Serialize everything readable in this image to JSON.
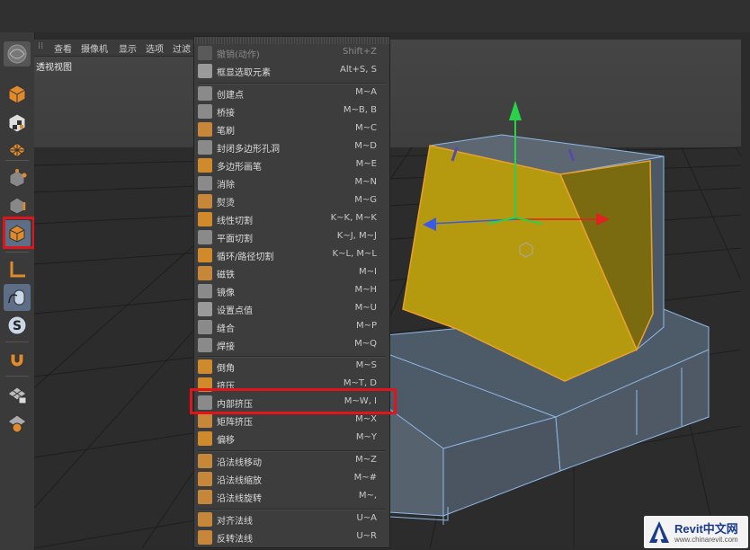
{
  "viewport": {
    "menu_items": [
      "查看",
      "摄像机",
      "显示",
      "选项",
      "过滤"
    ],
    "label": "透视视图"
  },
  "left_toolbar": {
    "tools": [
      {
        "icon": "cube-icon"
      },
      {
        "icon": "checker-cube-icon"
      },
      {
        "icon": "texture-grid-icon"
      },
      {
        "icon": "points-mode-icon"
      },
      {
        "icon": "edges-mode-icon"
      },
      {
        "icon": "polygons-mode-icon",
        "active": true
      },
      {
        "icon": "axis-mode-icon"
      },
      {
        "icon": "tweak-mouse-icon"
      },
      {
        "icon": "snap-s-icon"
      },
      {
        "icon": "magnet-icon"
      },
      {
        "icon": "lock-grid-icon"
      },
      {
        "icon": "workplane-icon"
      }
    ]
  },
  "context_menu": {
    "items": [
      {
        "label": "撤销(动作)",
        "shortcut": "Shift+Z",
        "icon": "undo-icon",
        "disabled": true
      },
      {
        "label": "框显选取元素",
        "shortcut": "Alt+S, S",
        "icon": "frame-selection-icon"
      },
      {
        "label": "创建点",
        "shortcut": "M~A",
        "icon": "create-point-icon"
      },
      {
        "label": "桥接",
        "shortcut": "M~B, B",
        "icon": "bridge-icon"
      },
      {
        "label": "笔刷",
        "shortcut": "M~C",
        "icon": "brush-icon"
      },
      {
        "label": "封闭多边形孔洞",
        "shortcut": "M~D",
        "icon": "close-hole-icon"
      },
      {
        "label": "多边形画笔",
        "shortcut": "M~E",
        "icon": "polygon-pen-icon"
      },
      {
        "label": "消除",
        "shortcut": "M~N",
        "icon": "dissolve-icon"
      },
      {
        "label": "熨烫",
        "shortcut": "M~G",
        "icon": "iron-icon"
      },
      {
        "label": "线性切割",
        "shortcut": "K~K, M~K",
        "icon": "line-cut-icon"
      },
      {
        "label": "平面切割",
        "shortcut": "K~J, M~J",
        "icon": "plane-cut-icon"
      },
      {
        "label": "循环/路径切割",
        "shortcut": "K~L, M~L",
        "icon": "loop-cut-icon"
      },
      {
        "label": "磁铁",
        "shortcut": "M~I",
        "icon": "magnet-icon"
      },
      {
        "label": "镜像",
        "shortcut": "M~H",
        "icon": "mirror-icon"
      },
      {
        "label": "设置点值",
        "shortcut": "M~U",
        "icon": "set-point-value-icon"
      },
      {
        "label": "缝合",
        "shortcut": "M~P",
        "icon": "stitch-icon"
      },
      {
        "label": "焊接",
        "shortcut": "M~Q",
        "icon": "weld-icon"
      },
      {
        "label": "倒角",
        "shortcut": "M~S",
        "icon": "bevel-icon"
      },
      {
        "label": "挤压",
        "shortcut": "M~T, D",
        "icon": "extrude-icon"
      },
      {
        "label": "内部挤压",
        "shortcut": "M~W, I",
        "icon": "extrude-inner-icon",
        "highlighted": true
      },
      {
        "label": "矩阵挤压",
        "shortcut": "M~X",
        "icon": "matrix-extrude-icon"
      },
      {
        "label": "偏移",
        "shortcut": "M~Y",
        "icon": "offset-icon"
      },
      {
        "label": "沿法线移动",
        "shortcut": "M~Z",
        "icon": "normal-move-icon"
      },
      {
        "label": "沿法线缩放",
        "shortcut": "M~#",
        "icon": "normal-scale-icon"
      },
      {
        "label": "沿法线旋转",
        "shortcut": "M~,",
        "icon": "normal-rotate-icon"
      },
      {
        "label": "对齐法线",
        "shortcut": "U~A",
        "icon": "align-normals-icon"
      },
      {
        "label": "反转法线",
        "shortcut": "U~R",
        "icon": "reverse-normals-icon"
      }
    ]
  },
  "watermark": {
    "title": "Revit中文网",
    "url": "www.chinarevit.com"
  },
  "colors": {
    "highlight_red": "#e0141b",
    "selection_yellow": "#b59a10",
    "mesh_blue": "#8fb9e8"
  }
}
